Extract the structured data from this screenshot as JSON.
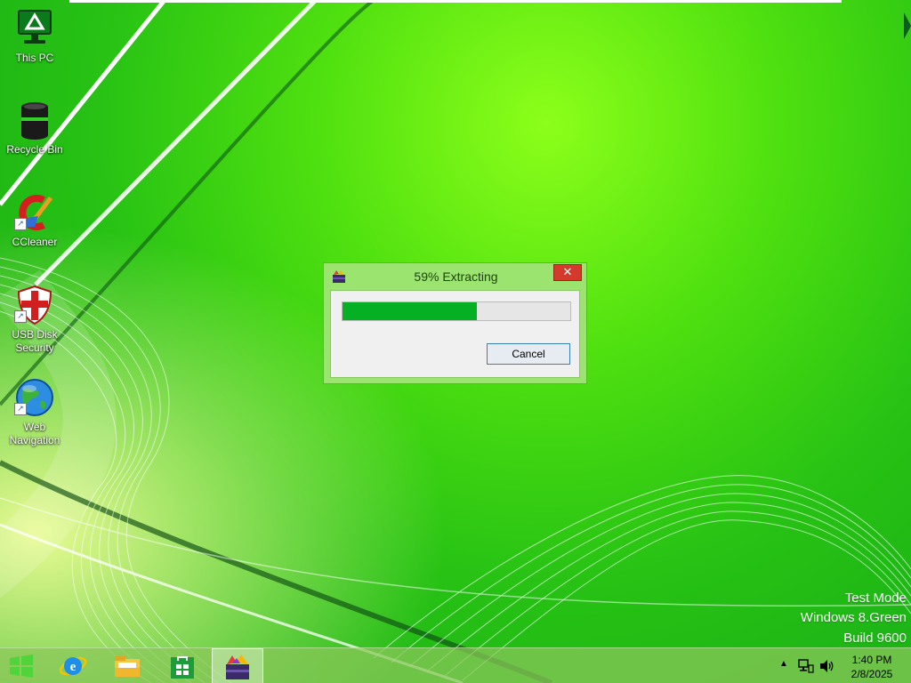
{
  "desktop": {
    "icons": [
      {
        "label": "This PC",
        "icon": "this-pc-icon"
      },
      {
        "label": "Recycle Bin",
        "icon": "recycle-bin-icon"
      },
      {
        "label": "CCleaner",
        "icon": "ccleaner-icon"
      },
      {
        "label": "USB Disk Security",
        "icon": "usb-disk-security-icon"
      },
      {
        "label": "Web Navigation",
        "icon": "web-navigation-icon"
      }
    ]
  },
  "dialog": {
    "title": "59% Extracting",
    "progress_percent": 59,
    "cancel_label": "Cancel",
    "close_glyph": "✕",
    "icon": "archive-icon"
  },
  "watermark": {
    "line1": "Test Mode",
    "line2": "Windows 8.Green",
    "line3": "Build 9600"
  },
  "taskbar": {
    "buttons": [
      "start-icon",
      "internet-explorer-icon",
      "file-explorer-icon",
      "store-icon",
      "extractor-app-icon"
    ],
    "tray": {
      "overflow_glyph": "▲",
      "icons": [
        "network-icon",
        "volume-icon"
      ],
      "time": "1:40 PM",
      "date": "2/8/2025"
    }
  },
  "colors": {
    "progress_fill": "#06b025",
    "close_button": "#d33a2c",
    "dialog_frame": "#9be46f"
  }
}
